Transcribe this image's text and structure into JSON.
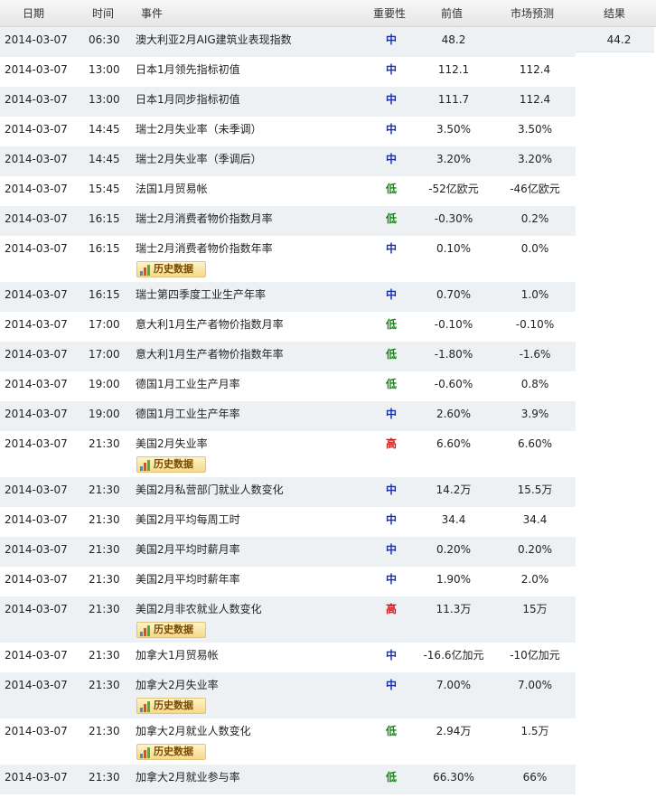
{
  "header": {
    "date": "日期",
    "time": "时间",
    "event": "事件",
    "importance": "重要性",
    "previous": "前值",
    "forecast": "市场预测",
    "result": "结果"
  },
  "history_label": "历史数据",
  "importance_colors": {
    "中": "#1a2fa8",
    "低": "#128a12",
    "高": "#d31414"
  },
  "rows": [
    {
      "date": "2014-03-07",
      "time": "06:30",
      "event": "澳大利亚2月AIG建筑业表现指数",
      "importance": "中",
      "previous": "48.2",
      "forecast": "",
      "result": "44.2",
      "history": false
    },
    {
      "date": "2014-03-07",
      "time": "13:00",
      "event": "日本1月领先指标初值",
      "importance": "中",
      "previous": "112.1",
      "forecast": "112.4",
      "result": "",
      "history": false
    },
    {
      "date": "2014-03-07",
      "time": "13:00",
      "event": "日本1月同步指标初值",
      "importance": "中",
      "previous": "111.7",
      "forecast": "112.4",
      "result": "",
      "history": false
    },
    {
      "date": "2014-03-07",
      "time": "14:45",
      "event": "瑞士2月失业率（未季调）",
      "importance": "中",
      "previous": "3.50%",
      "forecast": "3.50%",
      "result": "",
      "history": false
    },
    {
      "date": "2014-03-07",
      "time": "14:45",
      "event": "瑞士2月失业率（季调后）",
      "importance": "中",
      "previous": "3.20%",
      "forecast": "3.20%",
      "result": "",
      "history": false
    },
    {
      "date": "2014-03-07",
      "time": "15:45",
      "event": "法国1月贸易帐",
      "importance": "低",
      "previous": "-52亿欧元",
      "forecast": "-46亿欧元",
      "result": "",
      "history": false
    },
    {
      "date": "2014-03-07",
      "time": "16:15",
      "event": "瑞士2月消费者物价指数月率",
      "importance": "低",
      "previous": "-0.30%",
      "forecast": "0.2%",
      "result": "",
      "history": false
    },
    {
      "date": "2014-03-07",
      "time": "16:15",
      "event": "瑞士2月消费者物价指数年率",
      "importance": "中",
      "previous": "0.10%",
      "forecast": "0.0%",
      "result": "",
      "history": true
    },
    {
      "date": "2014-03-07",
      "time": "16:15",
      "event": "瑞士第四季度工业生产年率",
      "importance": "中",
      "previous": "0.70%",
      "forecast": "1.0%",
      "result": "",
      "history": false
    },
    {
      "date": "2014-03-07",
      "time": "17:00",
      "event": "意大利1月生产者物价指数月率",
      "importance": "低",
      "previous": "-0.10%",
      "forecast": "-0.10%",
      "result": "",
      "history": false
    },
    {
      "date": "2014-03-07",
      "time": "17:00",
      "event": "意大利1月生产者物价指数年率",
      "importance": "低",
      "previous": "-1.80%",
      "forecast": "-1.6%",
      "result": "",
      "history": false
    },
    {
      "date": "2014-03-07",
      "time": "19:00",
      "event": "德国1月工业生产月率",
      "importance": "低",
      "previous": "-0.60%",
      "forecast": "0.8%",
      "result": "",
      "history": false
    },
    {
      "date": "2014-03-07",
      "time": "19:00",
      "event": "德国1月工业生产年率",
      "importance": "中",
      "previous": "2.60%",
      "forecast": "3.9%",
      "result": "",
      "history": false
    },
    {
      "date": "2014-03-07",
      "time": "21:30",
      "event": "美国2月失业率",
      "importance": "高",
      "previous": "6.60%",
      "forecast": "6.60%",
      "result": "",
      "history": true
    },
    {
      "date": "2014-03-07",
      "time": "21:30",
      "event": "美国2月私营部门就业人数变化",
      "importance": "中",
      "previous": "14.2万",
      "forecast": "15.5万",
      "result": "",
      "history": false
    },
    {
      "date": "2014-03-07",
      "time": "21:30",
      "event": "美国2月平均每周工时",
      "importance": "中",
      "previous": "34.4",
      "forecast": "34.4",
      "result": "",
      "history": false
    },
    {
      "date": "2014-03-07",
      "time": "21:30",
      "event": "美国2月平均时薪月率",
      "importance": "中",
      "previous": "0.20%",
      "forecast": "0.20%",
      "result": "",
      "history": false
    },
    {
      "date": "2014-03-07",
      "time": "21:30",
      "event": "美国2月平均时薪年率",
      "importance": "中",
      "previous": "1.90%",
      "forecast": "2.0%",
      "result": "",
      "history": false
    },
    {
      "date": "2014-03-07",
      "time": "21:30",
      "event": "美国2月非农就业人数变化",
      "importance": "高",
      "previous": "11.3万",
      "forecast": "15万",
      "result": "",
      "history": true
    },
    {
      "date": "2014-03-07",
      "time": "21:30",
      "event": "加拿大1月贸易帐",
      "importance": "中",
      "previous": "-16.6亿加元",
      "forecast": "-10亿加元",
      "result": "",
      "history": false
    },
    {
      "date": "2014-03-07",
      "time": "21:30",
      "event": "加拿大2月失业率",
      "importance": "中",
      "previous": "7.00%",
      "forecast": "7.00%",
      "result": "",
      "history": true
    },
    {
      "date": "2014-03-07",
      "time": "21:30",
      "event": "加拿大2月就业人数变化",
      "importance": "低",
      "previous": "2.94万",
      "forecast": "1.5万",
      "result": "",
      "history": true
    },
    {
      "date": "2014-03-07",
      "time": "21:30",
      "event": "加拿大2月就业参与率",
      "importance": "低",
      "previous": "66.30%",
      "forecast": "66%",
      "result": "",
      "history": false
    }
  ]
}
